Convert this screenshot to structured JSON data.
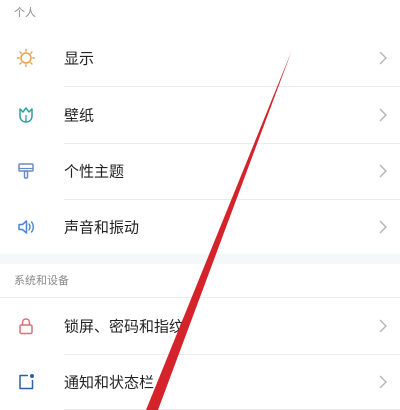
{
  "sections": [
    {
      "header": "个人",
      "items": [
        {
          "label": "显示",
          "icon": "sun-icon",
          "color": "#e8a34a"
        },
        {
          "label": "壁纸",
          "icon": "tulip-icon",
          "color": "#2aa39a"
        },
        {
          "label": "个性主题",
          "icon": "brush-icon",
          "color": "#6a8ac4"
        },
        {
          "label": "声音和振动",
          "icon": "speaker-icon",
          "color": "#4a86d4"
        }
      ]
    },
    {
      "header": "系统和设备",
      "items": [
        {
          "label": "锁屏、密码和指纹",
          "icon": "lock-icon",
          "color": "#d8707a"
        },
        {
          "label": "通知和状态栏",
          "icon": "notification-icon",
          "color": "#2f5ea8"
        }
      ]
    }
  ],
  "colors": {
    "annotation": "#d4232a",
    "chevron": "#b5b5b5",
    "divider": "#ececec",
    "section_gap": "#f4f8f8"
  }
}
